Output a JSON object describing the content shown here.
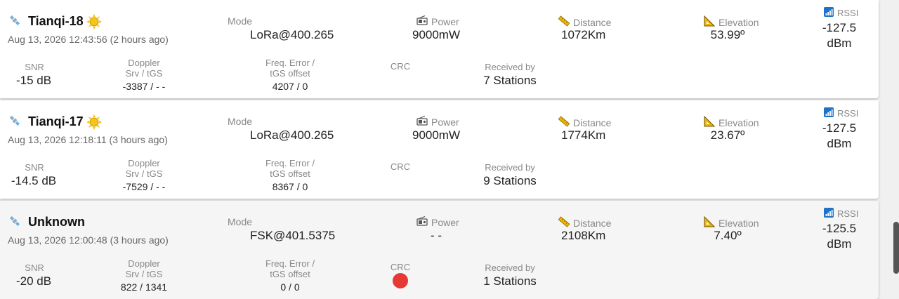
{
  "labels": {
    "mode": "Mode",
    "power": "Power",
    "distance": "Distance",
    "elevation": "Elevation",
    "rssi": "RSSI",
    "snr": "SNR",
    "doppler_1": "Doppler",
    "doppler_2": "Srv / tGS",
    "freq_1": "Freq. Error /",
    "freq_2": "tGS offset",
    "crc": "CRC",
    "received_by": "Received by",
    "rssi_unit": "dBm"
  },
  "packets": [
    {
      "name": "Tianqi-18",
      "timestamp": "Aug 13, 2026 12:43:56 (2 hours ago)",
      "mode": "LoRa@400.265",
      "power": "9000mW",
      "distance": "1072Km",
      "elevation": "53.99º",
      "rssi": "-127.5",
      "snr": "-15 dB",
      "doppler": "-3387 / - -",
      "freq_error": "4207 / 0",
      "received": "7 Stations",
      "sunlit": true,
      "crc_error": false
    },
    {
      "name": "Tianqi-17",
      "timestamp": "Aug 13, 2026 12:18:11 (3 hours ago)",
      "mode": "LoRa@400.265",
      "power": "9000mW",
      "distance": "1774Km",
      "elevation": "23.67º",
      "rssi": "-127.5",
      "snr": "-14.5 dB",
      "doppler": "-7529 / - -",
      "freq_error": "8367 / 0",
      "received": "9 Stations",
      "sunlit": true,
      "crc_error": false
    },
    {
      "name": "Unknown",
      "timestamp": "Aug 13, 2026 12:00:48 (3 hours ago)",
      "mode": "FSK@401.5375",
      "power": "- -",
      "distance": "2108Km",
      "elevation": "7.40º",
      "rssi": "-125.5",
      "snr": "-20 dB",
      "doppler": "822 / 1341",
      "freq_error": "0 / 0",
      "received": "1 Stations",
      "sunlit": false,
      "crc_error": true
    }
  ],
  "colors": {
    "crc_error": "#e53935",
    "sun": "#f5c518",
    "rssi_icon": "#1e73c8",
    "ruler": "#e0a800"
  }
}
